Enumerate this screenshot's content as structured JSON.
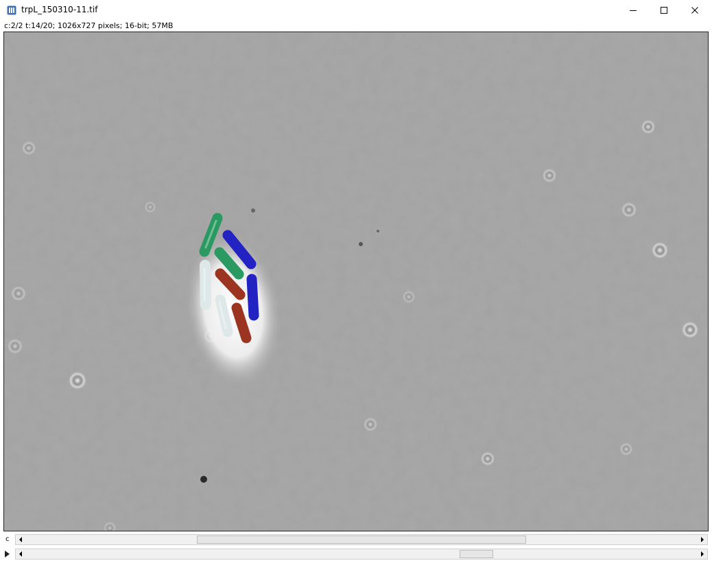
{
  "window": {
    "title": "trpL_150310-11.tif"
  },
  "info_bar": "c:2/2 t:14/20; 1026x727 pixels; 16-bit; 57MB",
  "channel_scroll": {
    "label": "c",
    "position": 0.5,
    "extent": 0.49
  },
  "frame_scroll": {
    "position": 0.68,
    "extent": 0.05
  },
  "overlay_colors": {
    "green": "#2b9a62",
    "blue": "#2323c4",
    "red": "#9b3522",
    "white": "#dfe8e8"
  }
}
